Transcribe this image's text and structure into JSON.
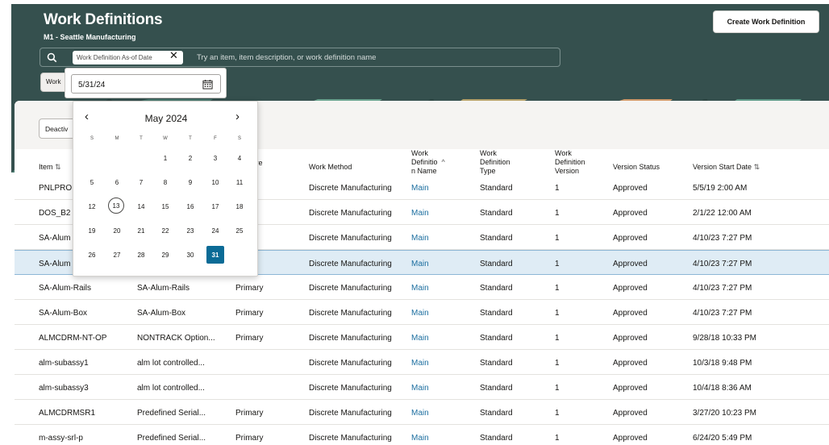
{
  "header": {
    "title": "Work Definitions",
    "subtitle": "M1 - Seattle Manufacturing",
    "create_button": "Create Work Definition"
  },
  "search": {
    "chip_label": "Work Definition As-of Date",
    "placeholder": "Try an item, item description, or work definition name"
  },
  "filter_chip": "Work",
  "toolbar": {
    "deactivate_label": "Deactiv"
  },
  "columns": {
    "item": "Item",
    "structure": "ture",
    "work_method": "Work Method",
    "wd_name_1": "Work",
    "wd_name_2": "Definitio",
    "wd_name_3": "n Name",
    "wd_type_1": "Work",
    "wd_type_2": "Definition",
    "wd_type_3": "Type",
    "wd_version_1": "Work",
    "wd_version_2": "Definition",
    "wd_version_3": "Version",
    "version_status": "Version Status",
    "version_start": "Version Start Date"
  },
  "rows": [
    {
      "item": "PNLPRO",
      "desc": "",
      "structure": "",
      "method": "Discrete Manufacturing",
      "name": "Main",
      "type": "Standard",
      "version": "1",
      "status": "Approved",
      "start": "5/5/19 2:00 AM"
    },
    {
      "item": "DOS_B2",
      "desc": "",
      "structure": "",
      "method": "Discrete Manufacturing",
      "name": "Main",
      "type": "Standard",
      "version": "1",
      "status": "Approved",
      "start": "2/1/22 12:00 AM"
    },
    {
      "item": "SA-Alum",
      "desc": "",
      "structure": "ry",
      "method": "Discrete Manufacturing",
      "name": "Main",
      "type": "Standard",
      "version": "1",
      "status": "Approved",
      "start": "4/10/23 7:27 PM"
    },
    {
      "item": "SA-Alum",
      "desc": "",
      "structure": "ry",
      "method": "Discrete Manufacturing",
      "name": "Main",
      "type": "Standard",
      "version": "1",
      "status": "Approved",
      "start": "4/10/23 7:27 PM"
    },
    {
      "item": "SA-Alum-Rails",
      "desc": "SA-Alum-Rails",
      "structure": "Primary",
      "method": "Discrete Manufacturing",
      "name": "Main",
      "type": "Standard",
      "version": "1",
      "status": "Approved",
      "start": "4/10/23 7:27 PM"
    },
    {
      "item": "SA-Alum-Box",
      "desc": "SA-Alum-Box",
      "structure": "Primary",
      "method": "Discrete Manufacturing",
      "name": "Main",
      "type": "Standard",
      "version": "1",
      "status": "Approved",
      "start": "4/10/23 7:27 PM"
    },
    {
      "item": "ALMCDRM-NT-OP",
      "desc": "NONTRACK Option...",
      "structure": "Primary",
      "method": "Discrete Manufacturing",
      "name": "Main",
      "type": "Standard",
      "version": "1",
      "status": "Approved",
      "start": "9/28/18 10:33 PM"
    },
    {
      "item": "alm-subassy1",
      "desc": "alm lot controlled...",
      "structure": "",
      "method": "Discrete Manufacturing",
      "name": "Main",
      "type": "Standard",
      "version": "1",
      "status": "Approved",
      "start": "10/3/18 9:48 PM"
    },
    {
      "item": "alm-subassy3",
      "desc": "alm lot controlled...",
      "structure": "",
      "method": "Discrete Manufacturing",
      "name": "Main",
      "type": "Standard",
      "version": "1",
      "status": "Approved",
      "start": "10/4/18 8:36 AM"
    },
    {
      "item": "ALMCDRMSR1",
      "desc": "Predefined Serial...",
      "structure": "Primary",
      "method": "Discrete Manufacturing",
      "name": "Main",
      "type": "Standard",
      "version": "1",
      "status": "Approved",
      "start": "3/27/20 10:23 PM"
    },
    {
      "item": "m-assy-srl-p",
      "desc": "Predefined Serial...",
      "structure": "Primary",
      "method": "Discrete Manufacturing",
      "name": "Main",
      "type": "Standard",
      "version": "1",
      "status": "Approved",
      "start": "6/24/20 5:49 PM"
    }
  ],
  "selected_row": 3,
  "date_picker": {
    "value": "5/31/24",
    "month_label": "May 2024",
    "weekdays": [
      "S",
      "M",
      "T",
      "W",
      "T",
      "F",
      "S"
    ],
    "weeks": [
      [
        "",
        "",
        "",
        "1",
        "2",
        "3",
        "4"
      ],
      [
        "5",
        "6",
        "7",
        "8",
        "9",
        "10",
        "11"
      ],
      [
        "12",
        "13",
        "14",
        "15",
        "16",
        "17",
        "18"
      ],
      [
        "19",
        "20",
        "21",
        "22",
        "23",
        "24",
        "25"
      ],
      [
        "26",
        "27",
        "28",
        "29",
        "30",
        "31",
        ""
      ]
    ],
    "today": "13",
    "selected": "31"
  },
  "colors": {
    "header_bg": "#35504e",
    "link": "#1d6fa0",
    "selected_day": "#0b6b96",
    "selected_row": "#dfecf5"
  },
  "icons": [
    "search-icon",
    "close-icon",
    "calendar-icon",
    "chevron-left-icon",
    "chevron-right-icon",
    "sort-icon"
  ]
}
